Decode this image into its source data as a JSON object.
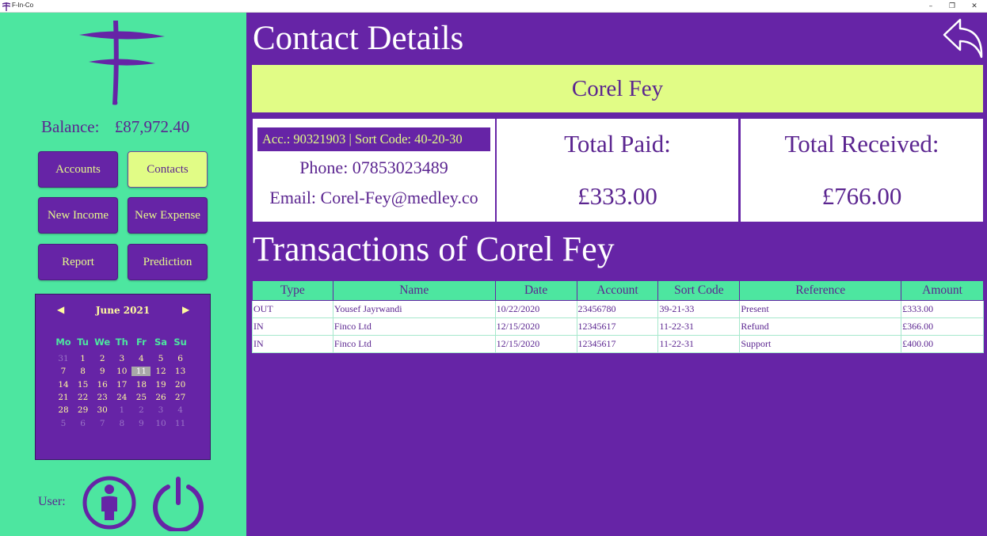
{
  "window": {
    "title": "F-In-Co",
    "controls": {
      "minimize": "–",
      "restore": "❐",
      "close": "✕"
    }
  },
  "sidebar": {
    "balance_label": "Balance:",
    "balance_value": "£87,972.40",
    "buttons": {
      "accounts": "Accounts",
      "contacts": "Contacts",
      "new_income": "New Income",
      "new_expense": "New Expense",
      "report": "Report",
      "prediction": "Prediction"
    },
    "active_button": "contacts",
    "calendar": {
      "month": "June 2021",
      "prev_arrow": "◀",
      "next_arrow": "▶",
      "days_of_week": [
        "Mo",
        "Tu",
        "We",
        "Th",
        "Fr",
        "Sa",
        "Su"
      ],
      "weeks": [
        [
          "31",
          "1",
          "2",
          "3",
          "4",
          "5",
          "6"
        ],
        [
          "7",
          "8",
          "9",
          "10",
          "11",
          "12",
          "13"
        ],
        [
          "14",
          "15",
          "16",
          "17",
          "18",
          "19",
          "20"
        ],
        [
          "21",
          "22",
          "23",
          "24",
          "25",
          "26",
          "27"
        ],
        [
          "28",
          "29",
          "30",
          "1",
          "2",
          "3",
          "4"
        ],
        [
          "5",
          "6",
          "7",
          "8",
          "9",
          "10",
          "11"
        ]
      ],
      "today": "11"
    },
    "user_label": "User:"
  },
  "main": {
    "title": "Contact Details",
    "contact_name": "Corel Fey",
    "account_line": "Acc.: 90321903 | Sort Code: 40-20-30",
    "phone": "Phone: 07853023489",
    "email": "Email: Corel-Fey@medley.co",
    "total_paid_label": "Total Paid:",
    "total_paid_value": "£333.00",
    "total_received_label": "Total Received:",
    "total_received_value": "£766.00",
    "transactions_title": "Transactions of Corel Fey",
    "table": {
      "columns": [
        "Type",
        "Name",
        "Date",
        "Account",
        "Sort Code",
        "Reference",
        "Amount"
      ],
      "rows": [
        [
          "OUT",
          "Yousef Jayrwandi",
          "10/22/2020",
          "23456780",
          "39-21-33",
          "Present",
          "£333.00"
        ],
        [
          "IN",
          "Finco Ltd",
          "12/15/2020",
          "12345617",
          "11-22-31",
          "Refund",
          "£366.00"
        ],
        [
          "IN",
          "Finco Ltd",
          "12/15/2020",
          "12345617",
          "11-22-31",
          "Support",
          "£400.00"
        ]
      ]
    }
  },
  "colors": {
    "purple": "#6624a6",
    "green": "#4de6a0",
    "lime": "#e1fc86",
    "text_purple": "#5b2590"
  }
}
